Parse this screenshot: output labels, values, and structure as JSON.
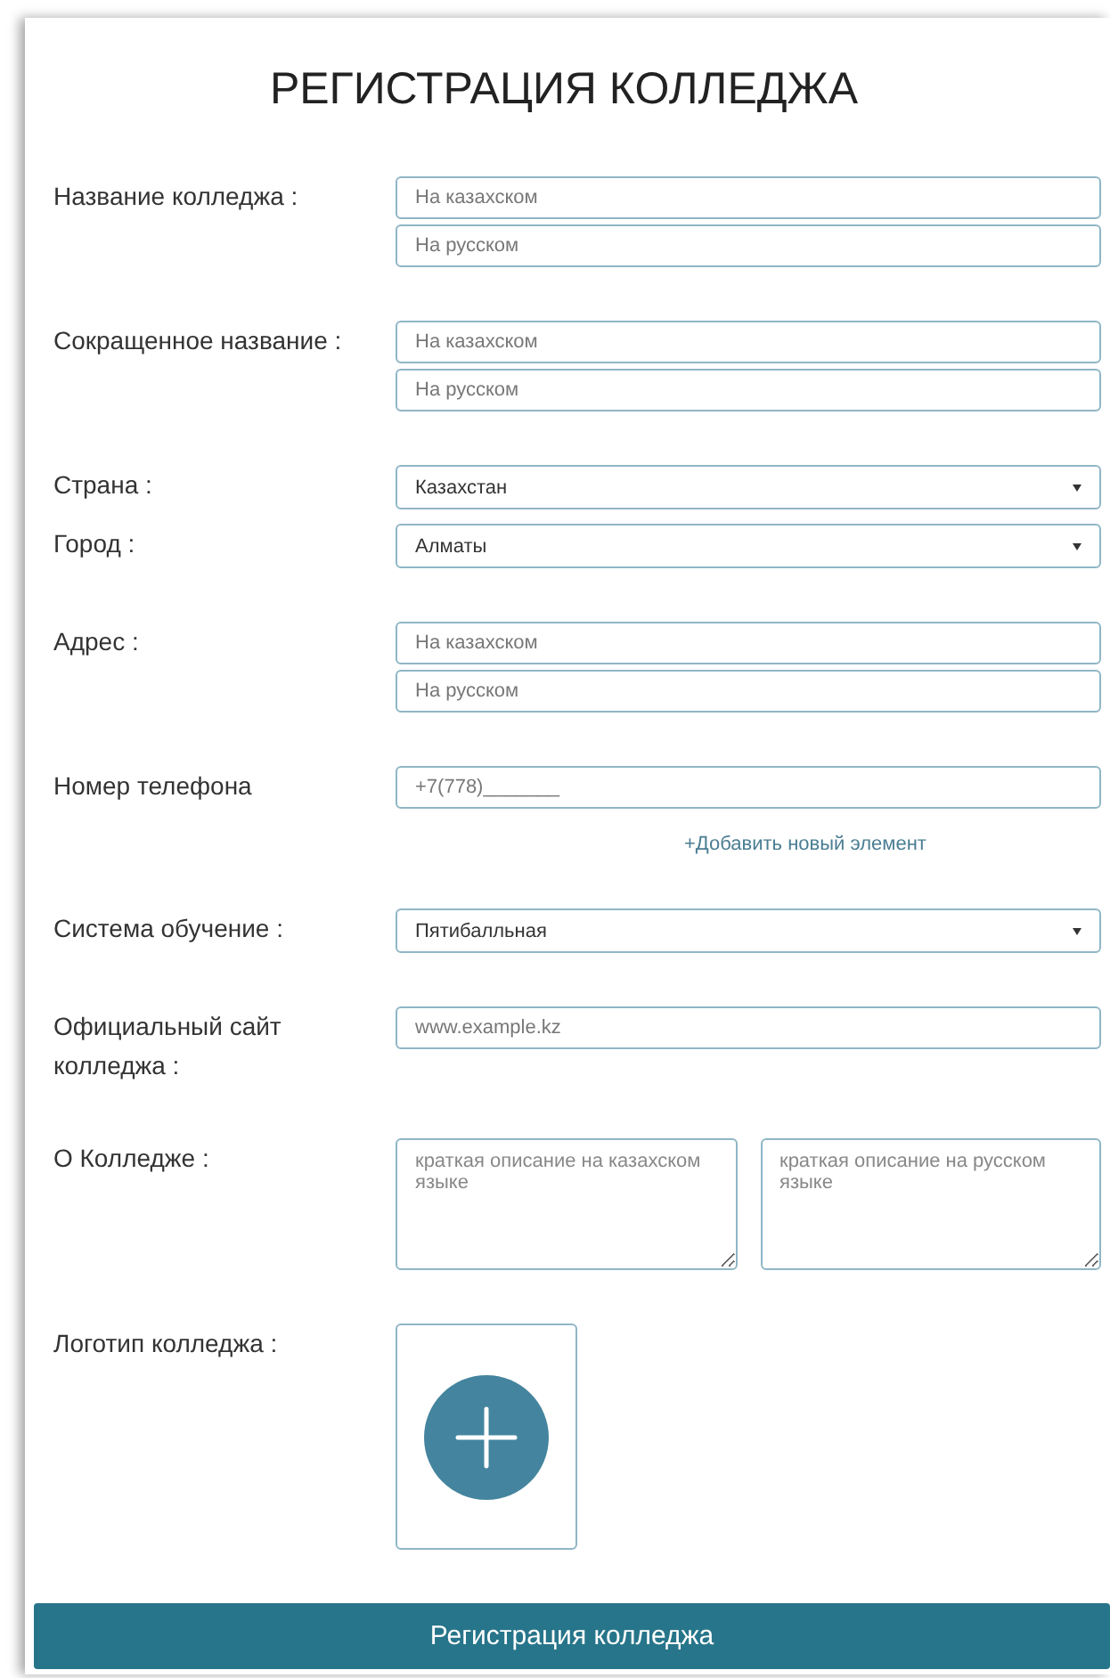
{
  "title": "РЕГИСТРАЦИЯ КОЛЛЕДЖА",
  "rows": [
    {
      "kind": "inputs",
      "label": "Название колледжа :",
      "fields": [
        {
          "placeholder": "На казахском"
        },
        {
          "placeholder": "На русском"
        }
      ]
    },
    {
      "kind": "inputs",
      "label": "Сокращенное название :",
      "fields": [
        {
          "placeholder": "На казахском"
        },
        {
          "placeholder": "На русском"
        }
      ]
    },
    {
      "kind": "select",
      "label": "Страна :",
      "value": "Казахстан"
    },
    {
      "kind": "select",
      "label": "Город :",
      "value": "Алматы"
    },
    {
      "kind": "inputs",
      "label": "Адрес :",
      "fields": [
        {
          "placeholder": "На казахском"
        },
        {
          "placeholder": "На русском"
        }
      ]
    },
    {
      "kind": "inputs",
      "label": "Номер телефона",
      "fields": [
        {
          "placeholder": "+7(778)_______"
        }
      ],
      "link": "+Добавить новый элемент"
    },
    {
      "kind": "select",
      "label": "Система обучение :",
      "value": "Пятибалльная"
    },
    {
      "kind": "inputs",
      "label": "Официальный сайт колледжа :",
      "fields": [
        {
          "placeholder": "www.example.kz"
        }
      ]
    },
    {
      "kind": "textareas",
      "label": "О Колледже :",
      "fields": [
        {
          "placeholder": "краткая описание на казахском языке"
        },
        {
          "placeholder": "краткая описание на русском языке"
        }
      ]
    },
    {
      "kind": "logo",
      "label": "Логотип колледжа :"
    }
  ],
  "submit": "Регистрация колледжа"
}
